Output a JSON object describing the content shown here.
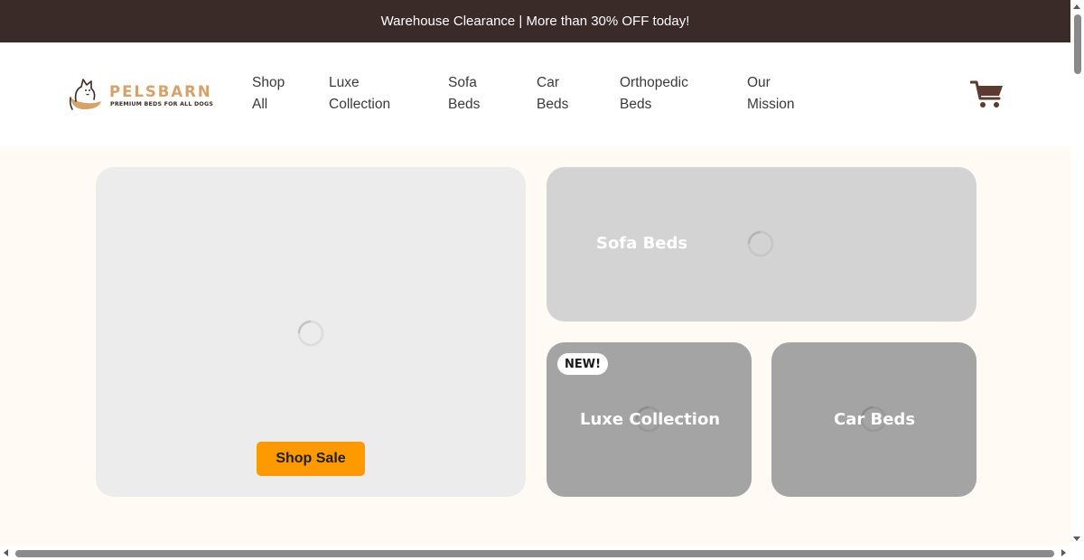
{
  "announcement": {
    "text": "Warehouse Clearance | More than 30% OFF today!"
  },
  "brand": {
    "name": "PELSBARN",
    "tagline": "PREMIUM BEDS FOR ALL DOGS",
    "logo_icon": "dog-bed-logo-icon",
    "accent_color": "#d4a26a",
    "dark_color": "#3b2b26"
  },
  "nav": {
    "items": [
      {
        "label": "Shop All"
      },
      {
        "label": "Luxe Collection"
      },
      {
        "label": "Sofa Beds"
      },
      {
        "label": "Car Beds"
      },
      {
        "label": "Orthopedic Beds"
      },
      {
        "label": "Our Mission"
      }
    ],
    "cart_icon": "shopping-cart-icon"
  },
  "hero": {
    "button_label": "Shop Sale",
    "button_color": "#ff9900"
  },
  "categories": {
    "sofa": {
      "title": "Sofa Beds"
    },
    "luxe": {
      "title": "Luxe Collection",
      "badge": "NEW!"
    },
    "car": {
      "title": "Car Beds"
    }
  },
  "loading_icon": "loading-spinner-icon",
  "colors": {
    "announcement_bg": "#3a2a28",
    "page_bg": "#fffaf4",
    "card_light": "#ececec",
    "card_mid": "#d3d3d3",
    "card_dark": "#a4a4a4"
  }
}
